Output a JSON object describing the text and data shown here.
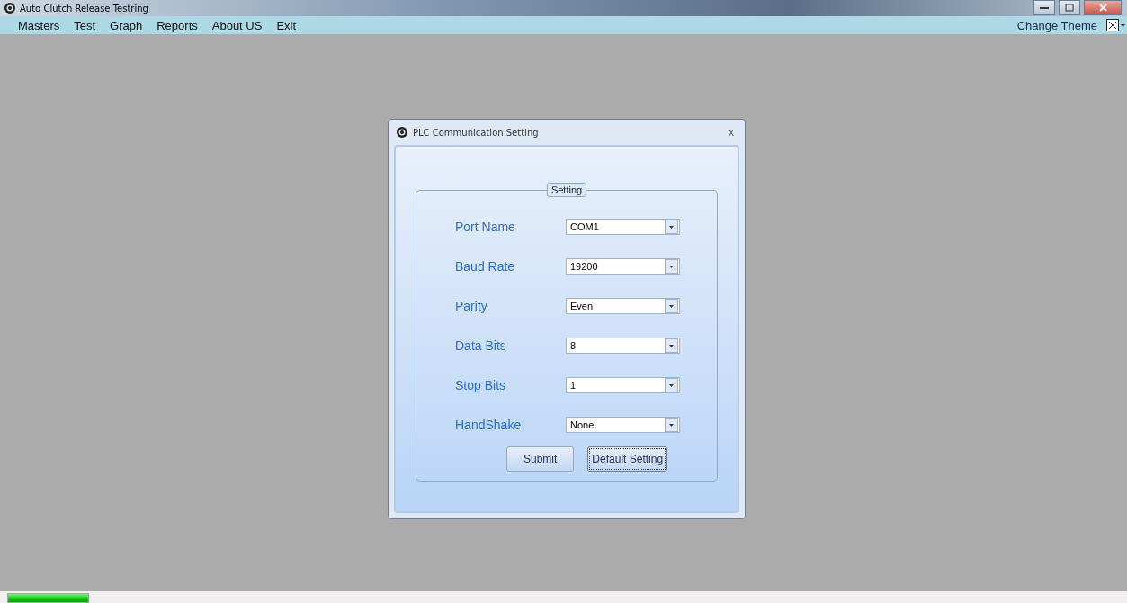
{
  "window": {
    "title": "Auto Clutch Release Testring"
  },
  "menu": {
    "items": [
      "Masters",
      "Test",
      "Graph",
      "Reports",
      "About US",
      "Exit"
    ],
    "right_label": "Change Theme"
  },
  "dialog": {
    "title": "PLC Communication Setting",
    "close": "x",
    "group_title": "Setting",
    "fields": [
      {
        "label": "Port Name",
        "value": "COM1"
      },
      {
        "label": "Baud Rate",
        "value": "19200"
      },
      {
        "label": "Parity",
        "value": "Even"
      },
      {
        "label": "Data Bits",
        "value": "8"
      },
      {
        "label": "Stop Bits",
        "value": "1"
      },
      {
        "label": "HandShake",
        "value": "None"
      }
    ],
    "buttons": [
      {
        "label": "Submit",
        "focused": false
      },
      {
        "label": "Default Setting",
        "focused": true
      }
    ]
  },
  "status_bar": {
    "progress": {
      "level": 1
    }
  }
}
